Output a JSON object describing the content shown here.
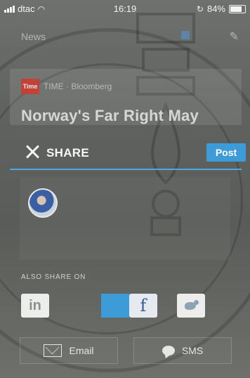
{
  "status_bar": {
    "carrier": "dtac",
    "time": "16:19",
    "battery": "84%",
    "battery_level": 0.84
  },
  "background_app": {
    "nav_title": "News",
    "source_logo": "Time",
    "source_text": "TIME · Bloomberg",
    "headline": "Norway's Far Right May"
  },
  "share_sheet": {
    "title": "SHARE",
    "post_label": "Post",
    "also_share_label": "ALSO SHARE ON",
    "linkedin_label": "in",
    "facebook_label": "f",
    "email_label": "Email",
    "sms_label": "SMS",
    "accent_color": "#3d9bd8"
  }
}
